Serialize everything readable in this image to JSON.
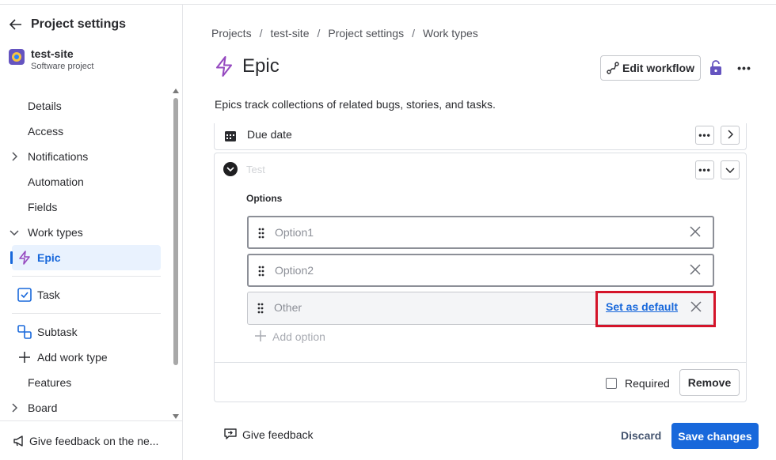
{
  "sidebar": {
    "title": "Project settings",
    "project": {
      "name": "test-site",
      "type": "Software project"
    },
    "items": [
      {
        "label": "Details"
      },
      {
        "label": "Access"
      },
      {
        "label": "Notifications"
      },
      {
        "label": "Automation"
      },
      {
        "label": "Fields"
      },
      {
        "label": "Work types"
      },
      {
        "label": "Epic"
      },
      {
        "label": "Task"
      },
      {
        "label": "Subtask"
      },
      {
        "label": "Add work type"
      },
      {
        "label": "Features"
      },
      {
        "label": "Board"
      }
    ],
    "feedback_label": "Give feedback on the ne..."
  },
  "breadcrumb": [
    "Projects",
    "test-site",
    "Project settings",
    "Work types"
  ],
  "page": {
    "title": "Epic",
    "description": "Epics track collections of related bugs, stories, and tasks.",
    "edit_workflow_label": "Edit workflow",
    "more_glyph": "•••"
  },
  "fields": {
    "due_date": {
      "label": "Due date"
    },
    "test": {
      "name": "Test",
      "options_label": "Options",
      "options": [
        "Option1",
        "Option2",
        "Other"
      ],
      "set_default_label": "Set as default",
      "add_option_label": "Add option",
      "required_label": "Required",
      "remove_label": "Remove"
    }
  },
  "footer": {
    "give_feedback_label": "Give feedback",
    "discard_label": "Discard",
    "save_label": "Save changes"
  },
  "colors": {
    "accent": "#1868db",
    "highlight": "#d4142a",
    "epic_purple": "#964ac0"
  }
}
